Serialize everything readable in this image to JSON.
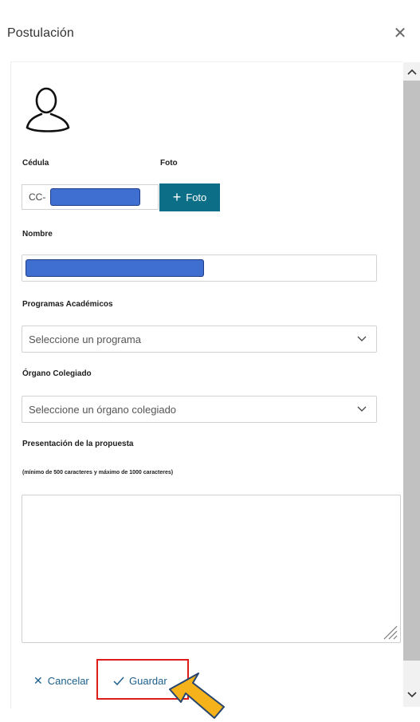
{
  "dialog": {
    "title": "Postulación",
    "close_icon": "close-icon"
  },
  "form": {
    "avatar_icon": "user-avatar-icon",
    "cedula_label": "Cédula",
    "foto_label": "Foto",
    "cedula_prefix": "CC-",
    "foto_button_label": "Foto",
    "foto_button_icon": "plus-icon",
    "nombre_label": "Nombre",
    "programas_label": "Programas Académicos",
    "programas_placeholder": "Seleccione un programa",
    "organo_label": "Órgano Colegiado",
    "organo_placeholder": "Seleccione un órgano colegiado",
    "presentacion_label": "Presentación de la propuesta",
    "presentacion_hint": "(mínimo de 500 caracteres y máximo de 1000 caracteres)",
    "presentacion_value": ""
  },
  "actions": {
    "cancel_label": "Cancelar",
    "save_label": "Guardar"
  },
  "colors": {
    "primary_button": "#0d6e88",
    "link_text": "#1b5f8d",
    "redaction_fill": "#3f6fd0",
    "highlight_border": "#e01b1b",
    "pointer_fill": "#f6b21b"
  }
}
